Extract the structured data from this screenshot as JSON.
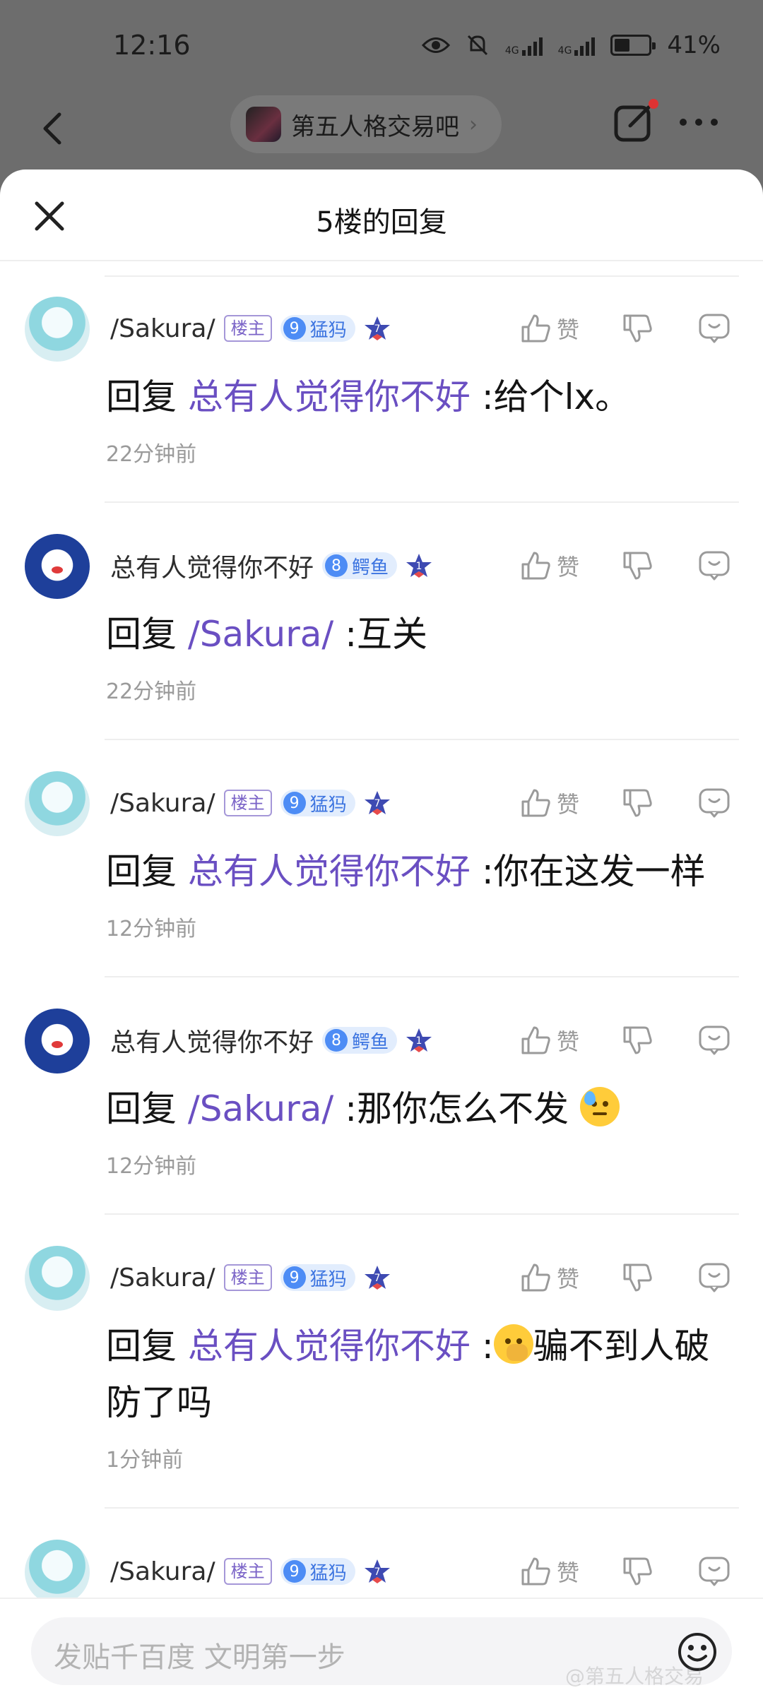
{
  "status": {
    "time": "12:16",
    "battery": "41%",
    "net1": "4G",
    "net2": "4G"
  },
  "nav": {
    "forum_name": "第五人格交易吧"
  },
  "sheet": {
    "title": "5楼的回复"
  },
  "labels": {
    "like": "赞",
    "owner": "楼主"
  },
  "replies": [
    {
      "user": "/Sakura/",
      "owner": true,
      "level": "9",
      "level_name": "猛犸",
      "star_level": "7",
      "avatar": "miku",
      "prefix": "回复",
      "mention": "总有人觉得你不好",
      "text": ":给个lx。",
      "time": "22分钟前"
    },
    {
      "user": "总有人觉得你不好",
      "owner": false,
      "level": "8",
      "level_name": "鳄鱼",
      "star_level": "1",
      "avatar": "bear",
      "prefix": "回复",
      "mention": "/Sakura/",
      "text": ":互关",
      "time": "22分钟前"
    },
    {
      "user": "/Sakura/",
      "owner": true,
      "level": "9",
      "level_name": "猛犸",
      "star_level": "7",
      "avatar": "miku",
      "prefix": "回复",
      "mention": "总有人觉得你不好",
      "text": ":你在这发一样",
      "time": "12分钟前"
    },
    {
      "user": "总有人觉得你不好",
      "owner": false,
      "level": "8",
      "level_name": "鳄鱼",
      "star_level": "1",
      "avatar": "bear",
      "prefix": "回复",
      "mention": "/Sakura/",
      "text": ":那你怎么不发",
      "time": "12分钟前"
    },
    {
      "user": "/Sakura/",
      "owner": true,
      "level": "9",
      "level_name": "猛犸",
      "star_level": "7",
      "avatar": "miku",
      "prefix": "回复",
      "mention": "总有人觉得你不好",
      "text": ":",
      "text2": "骗不到人破防了吗",
      "time": "1分钟前"
    },
    {
      "user": "/Sakura/",
      "owner": true,
      "level": "9",
      "level_name": "猛犸",
      "star_level": "7",
      "avatar": "miku"
    }
  ],
  "input": {
    "placeholder": "发贴千百度 文明第一步"
  },
  "watermark": "@第五人格交易"
}
